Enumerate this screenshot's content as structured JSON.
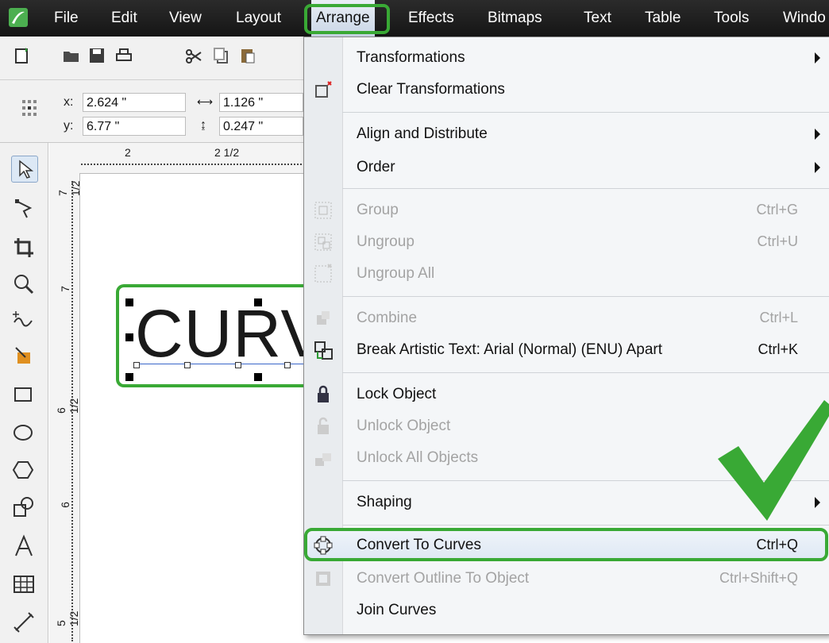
{
  "menubar": {
    "items": [
      "File",
      "Edit",
      "View",
      "Layout",
      "Arrange",
      "Effects",
      "Bitmaps",
      "Text",
      "Table",
      "Tools",
      "Windo"
    ],
    "active": "Arrange"
  },
  "propbar": {
    "x_label": "x:",
    "x_value": "2.624 \"",
    "y_label": "y:",
    "y_value": "6.77 \"",
    "w_value": "1.126 \"",
    "h_value": "0.247 \""
  },
  "ruler": {
    "top_ticks": [
      "2",
      "2 1/2"
    ],
    "left_ticks": [
      "7 1/2",
      "7",
      "6 1/2",
      "6",
      "5 1/2"
    ]
  },
  "canvas": {
    "text": "CURV"
  },
  "menu": {
    "items": [
      {
        "label": "Transformations",
        "shortcut": "",
        "submenu": true,
        "disabled": false
      },
      {
        "label": "Clear Transformations",
        "shortcut": "",
        "submenu": false,
        "disabled": false
      },
      {
        "label": "Align and Distribute",
        "shortcut": "",
        "submenu": true,
        "disabled": false
      },
      {
        "label": "Order",
        "shortcut": "",
        "submenu": true,
        "disabled": false
      },
      {
        "label": "Group",
        "shortcut": "Ctrl+G",
        "submenu": false,
        "disabled": true
      },
      {
        "label": "Ungroup",
        "shortcut": "Ctrl+U",
        "submenu": false,
        "disabled": true
      },
      {
        "label": "Ungroup All",
        "shortcut": "",
        "submenu": false,
        "disabled": true
      },
      {
        "label": "Combine",
        "shortcut": "Ctrl+L",
        "submenu": false,
        "disabled": true
      },
      {
        "label": "Break Artistic Text: Arial (Normal) (ENU) Apart",
        "shortcut": "Ctrl+K",
        "submenu": false,
        "disabled": false
      },
      {
        "label": "Lock Object",
        "shortcut": "",
        "submenu": false,
        "disabled": false
      },
      {
        "label": "Unlock Object",
        "shortcut": "",
        "submenu": false,
        "disabled": true
      },
      {
        "label": "Unlock All Objects",
        "shortcut": "",
        "submenu": false,
        "disabled": true
      },
      {
        "label": "Shaping",
        "shortcut": "",
        "submenu": true,
        "disabled": false
      },
      {
        "label": "Convert To Curves",
        "shortcut": "Ctrl+Q",
        "submenu": false,
        "disabled": false,
        "highlighted": true
      },
      {
        "label": "Convert Outline To Object",
        "shortcut": "Ctrl+Shift+Q",
        "submenu": false,
        "disabled": true
      },
      {
        "label": "Join Curves",
        "shortcut": "",
        "submenu": false,
        "disabled": false
      }
    ]
  },
  "colors": {
    "highlight_green": "#39a935",
    "menubar_bg": "#1f1f1f",
    "disabled_text": "#a3a3a3"
  }
}
